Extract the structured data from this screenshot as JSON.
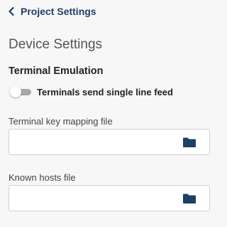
{
  "back_link": {
    "label": "Project Settings",
    "icon": "chevron-left-icon"
  },
  "section_title": "Device Settings",
  "terminal_emulation": {
    "title": "Terminal Emulation",
    "toggle": {
      "label": "Terminals send single line feed",
      "checked": false
    }
  },
  "fields": {
    "key_mapping": {
      "label": "Terminal key mapping file",
      "value": "",
      "icon": "folder-icon"
    },
    "known_hosts": {
      "label": "Known hosts file",
      "value": "",
      "icon": "folder-icon"
    }
  },
  "colors": {
    "accent": "#1e3f66",
    "background": "#f7f7f7",
    "toggle_off": "#a8a8a8"
  }
}
